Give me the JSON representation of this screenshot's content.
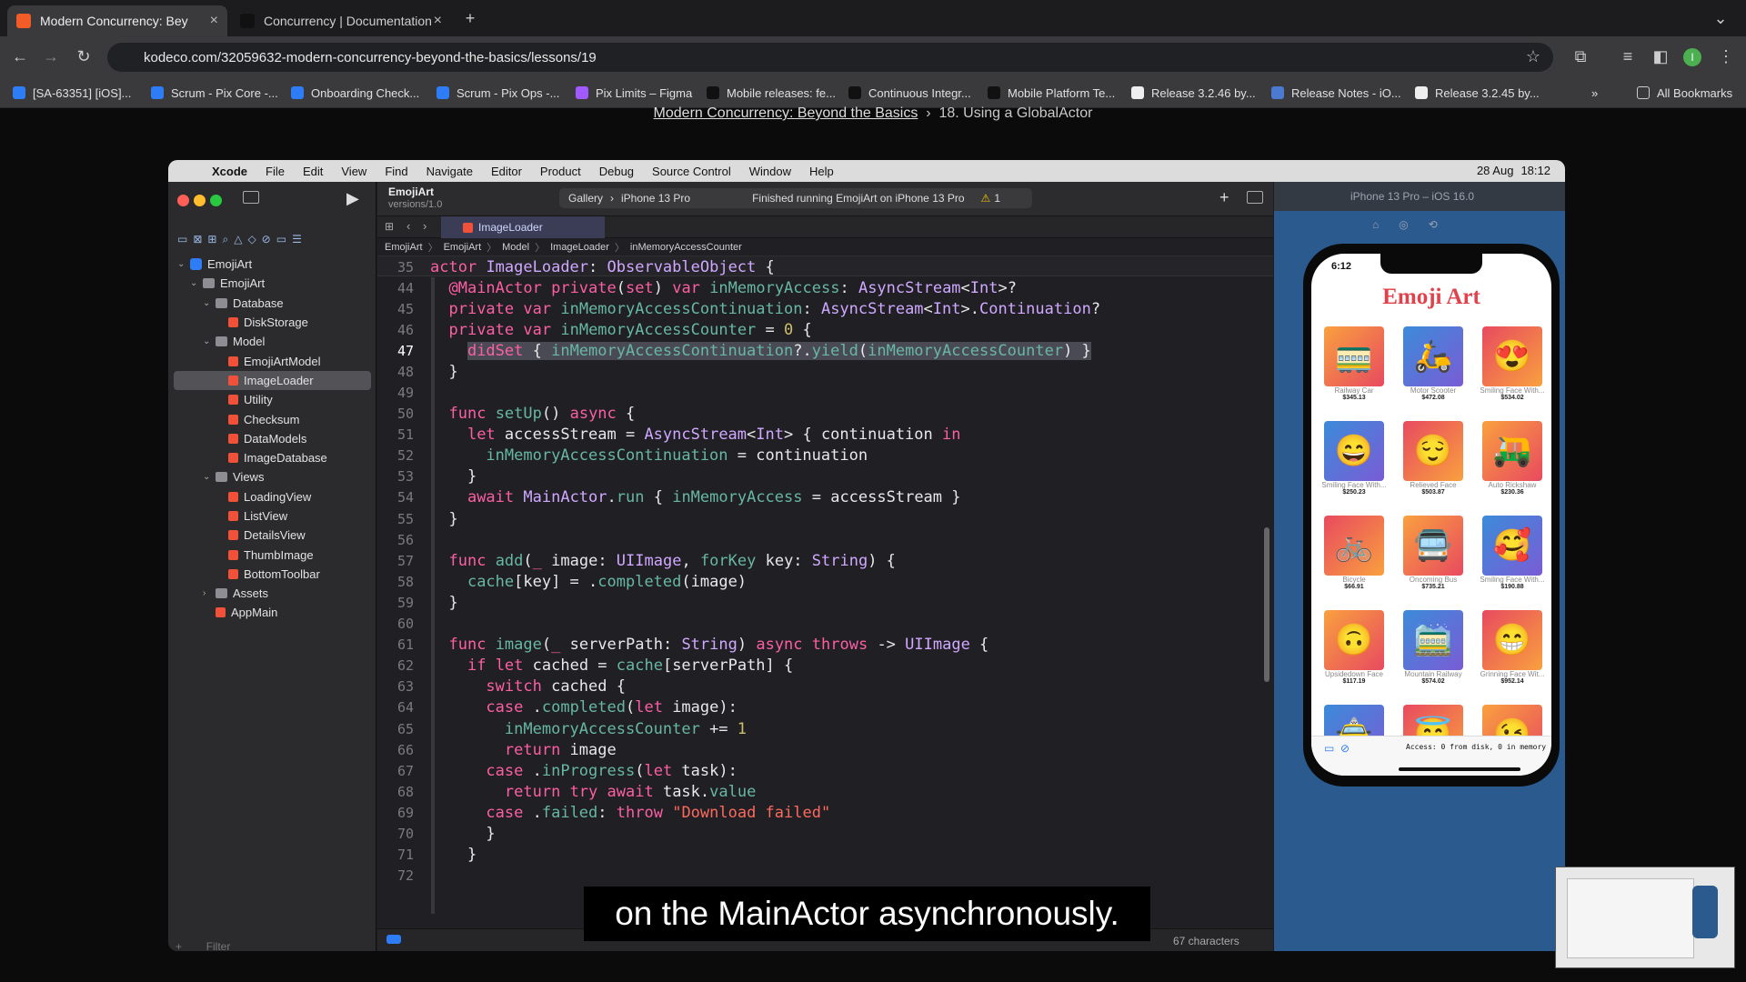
{
  "browser": {
    "tabs": [
      {
        "label": "Modern Concurrency: Bey",
        "icon": "kodeco-icon"
      },
      {
        "label": "Concurrency | Documentation",
        "icon": "apple-icon"
      }
    ],
    "url": "kodeco.com/32059632-modern-concurrency-beyond-the-basics/lessons/19",
    "bookmarks": [
      "[SA-63351] [iOS]...",
      "Scrum - Pix Core -...",
      "Onboarding Check...",
      "Scrum - Pix Ops -...",
      "Pix Limits – Figma",
      "Mobile releases: fe...",
      "Continuous Integr...",
      "Mobile Platform Te...",
      "Release 3.2.46 by...",
      "Release Notes - iO...",
      "Release 3.2.45 by..."
    ],
    "all_bookmarks": "All Bookmarks",
    "profile": "I"
  },
  "page": {
    "crumb1": "Modern Concurrency: Beyond the Basics",
    "sep": "›",
    "crumb2": "18. Using a GlobalActor"
  },
  "xcode": {
    "menu": [
      "Xcode",
      "File",
      "Edit",
      "View",
      "Find",
      "Navigate",
      "Editor",
      "Product",
      "Debug",
      "Source Control",
      "Window",
      "Help"
    ],
    "menu_right": {
      "date": "28 Aug",
      "time": "18:12"
    },
    "project": "EmojiArt",
    "version": "versions/1.0",
    "scheme": "Gallery",
    "device": "iPhone 13 Pro",
    "status": "Finished running EmojiArt on iPhone 13 Pro",
    "warnings": "1",
    "tab": "ImageLoader",
    "breadcrumbs": [
      "EmojiArt",
      "EmojiArt",
      "Model",
      "ImageLoader",
      "inMemoryAccessCounter"
    ],
    "tree": [
      {
        "label": "EmojiArt",
        "indent": 0,
        "kind": "app",
        "chev": "⌄"
      },
      {
        "label": "EmojiArt",
        "indent": 1,
        "kind": "folder",
        "chev": "⌄"
      },
      {
        "label": "Database",
        "indent": 2,
        "kind": "folder",
        "chev": "⌄"
      },
      {
        "label": "DiskStorage",
        "indent": 3,
        "kind": "swift"
      },
      {
        "label": "Model",
        "indent": 2,
        "kind": "folder",
        "chev": "⌄"
      },
      {
        "label": "EmojiArtModel",
        "indent": 3,
        "kind": "swift"
      },
      {
        "label": "ImageLoader",
        "indent": 3,
        "kind": "swift",
        "selected": true
      },
      {
        "label": "Utility",
        "indent": 3,
        "kind": "swift"
      },
      {
        "label": "Checksum",
        "indent": 3,
        "kind": "swift"
      },
      {
        "label": "DataModels",
        "indent": 3,
        "kind": "swift"
      },
      {
        "label": "ImageDatabase",
        "indent": 3,
        "kind": "swift"
      },
      {
        "label": "Views",
        "indent": 2,
        "kind": "folder",
        "chev": "⌄"
      },
      {
        "label": "LoadingView",
        "indent": 3,
        "kind": "swift"
      },
      {
        "label": "ListView",
        "indent": 3,
        "kind": "swift"
      },
      {
        "label": "DetailsView",
        "indent": 3,
        "kind": "swift"
      },
      {
        "label": "ThumbImage",
        "indent": 3,
        "kind": "swift"
      },
      {
        "label": "BottomToolbar",
        "indent": 3,
        "kind": "swift"
      },
      {
        "label": "Assets",
        "indent": 2,
        "kind": "folder",
        "chev": "›"
      },
      {
        "label": "AppMain",
        "indent": 2,
        "kind": "swift"
      }
    ],
    "filter_placeholder": "Filter",
    "sticky": {
      "num": "35",
      "html": "<span class='kw'>actor</span> <span class='ty'>ImageLoader</span>: <span class='ty'>ObservableObject</span> {"
    },
    "code": [
      {
        "n": "44",
        "h": "  <span class='kw'>@MainActor</span> <span class='kw'>private</span>(<span class='kw'>set</span>) <span class='kw'>var</span> <span class='pr'>inMemoryAccess</span>: <span class='ty'>AsyncStream</span>&lt;<span class='ty'>Int</span>&gt;?"
      },
      {
        "n": "45",
        "h": "  <span class='kw'>private</span> <span class='kw'>var</span> <span class='pr'>inMemoryAccessContinuation</span>: <span class='ty'>AsyncStream</span>&lt;<span class='ty'>Int</span>&gt;.<span class='ty'>Continuation</span>?"
      },
      {
        "n": "46",
        "h": "  <span class='kw'>private</span> <span class='kw'>var</span> <span class='pr'>inMemoryAccessCounter</span> = <span class='nu'>0</span> {"
      },
      {
        "n": "47",
        "h": "    <span class='hl'><span class='kw'>didSet</span> { <span class='pr'>inMemoryAccessContinuation</span>?.<span class='pr'>yield</span>(<span class='pr'>inMemoryAccessCounter</span>) }</span>",
        "cur": true
      },
      {
        "n": "48",
        "h": "  }"
      },
      {
        "n": "49",
        "h": ""
      },
      {
        "n": "50",
        "h": "  <span class='kw'>func</span> <span class='pr'>setUp</span>() <span class='kw'>async</span> {"
      },
      {
        "n": "51",
        "h": "    <span class='kw'>let</span> accessStream = <span class='ty'>AsyncStream</span>&lt;<span class='ty'>Int</span>&gt; { continuation <span class='kw'>in</span>"
      },
      {
        "n": "52",
        "h": "      <span class='pr'>inMemoryAccessContinuation</span> = continuation"
      },
      {
        "n": "53",
        "h": "    }"
      },
      {
        "n": "54",
        "h": "    <span class='kw'>await</span> <span class='ty'>MainActor</span>.<span class='pr'>run</span> { <span class='pr'>inMemoryAccess</span> = accessStream }"
      },
      {
        "n": "55",
        "h": "  }"
      },
      {
        "n": "56",
        "h": ""
      },
      {
        "n": "57",
        "h": "  <span class='kw'>func</span> <span class='pr'>add</span>(<span class='kw'>_</span> image: <span class='ty'>UIImage</span>, <span class='pr'>forKey</span> key: <span class='ty'>String</span>) {"
      },
      {
        "n": "58",
        "h": "    <span class='pr'>cache</span>[key] = .<span class='pr'>completed</span>(image)"
      },
      {
        "n": "59",
        "h": "  }"
      },
      {
        "n": "60",
        "h": ""
      },
      {
        "n": "61",
        "h": "  <span class='kw'>func</span> <span class='pr'>image</span>(<span class='kw'>_</span> serverPath: <span class='ty'>String</span>) <span class='kw'>async</span> <span class='kw'>throws</span> -&gt; <span class='ty'>UIImage</span> {"
      },
      {
        "n": "62",
        "h": "    <span class='kw'>if</span> <span class='kw'>let</span> cached = <span class='pr'>cache</span>[serverPath] {"
      },
      {
        "n": "63",
        "h": "      <span class='kw'>switch</span> cached {"
      },
      {
        "n": "64",
        "h": "      <span class='kw'>case</span> .<span class='pr'>completed</span>(<span class='kw'>let</span> image):"
      },
      {
        "n": "65",
        "h": "        <span class='pr'>inMemoryAccessCounter</span> += <span class='nu'>1</span>"
      },
      {
        "n": "66",
        "h": "        <span class='kw'>return</span> image"
      },
      {
        "n": "67",
        "h": "      <span class='kw'>case</span> .<span class='pr'>inProgress</span>(<span class='kw'>let</span> task):"
      },
      {
        "n": "68",
        "h": "        <span class='kw'>return</span> <span class='kw'>try</span> <span class='kw'>await</span> task.<span class='pr'>value</span>"
      },
      {
        "n": "69",
        "h": "      <span class='kw'>case</span> .<span class='pr'>failed</span>: <span class='kw'>throw</span> <span class='st'>\"Download failed\"</span>"
      },
      {
        "n": "70",
        "h": "      }"
      },
      {
        "n": "71",
        "h": "    }"
      },
      {
        "n": "72",
        "h": ""
      }
    ],
    "char_count": "67 characters"
  },
  "simulator": {
    "title": "iPhone 13 Pro – iOS 16.0",
    "time": "6:12",
    "app_title": "Emoji Art",
    "items": [
      {
        "emoji": "🚃",
        "name": "Railway Car",
        "price": "$345.13"
      },
      {
        "emoji": "🛵",
        "name": "Motor Scooter",
        "price": "$472.08"
      },
      {
        "emoji": "😍",
        "name": "Smiling Face With...",
        "price": "$534.02"
      },
      {
        "emoji": "😄",
        "name": "Smiling Face With...",
        "price": "$250.23"
      },
      {
        "emoji": "😌",
        "name": "Relieved Face",
        "price": "$503.87"
      },
      {
        "emoji": "🛺",
        "name": "Auto Rickshaw",
        "price": "$230.36"
      },
      {
        "emoji": "🚲",
        "name": "Bicycle",
        "price": "$66.91"
      },
      {
        "emoji": "🚍",
        "name": "Oncoming Bus",
        "price": "$735.21"
      },
      {
        "emoji": "🥰",
        "name": "Smiling Face With...",
        "price": "$190.88"
      },
      {
        "emoji": "🙃",
        "name": "Upsidedown Face",
        "price": "$117.19"
      },
      {
        "emoji": "🚞",
        "name": "Mountain Railway",
        "price": "$574.02"
      },
      {
        "emoji": "😁",
        "name": "Grinning Face Wit...",
        "price": "$952.14"
      },
      {
        "emoji": "🚖",
        "name": "",
        "price": ""
      },
      {
        "emoji": "😇",
        "name": "",
        "price": ""
      },
      {
        "emoji": "😉",
        "name": "",
        "price": ""
      }
    ],
    "status": "Access: 0 from disk, 0 in memory"
  },
  "subtitle": "on the MainActor asynchronously.",
  "colors": {
    "xcode_bg": "#1f1f24",
    "keyword": "#fc5fa3",
    "type": "#d0a8ff",
    "property": "#67b7a4",
    "swift_icon": "#f05138",
    "accent": "#2e7cf6"
  }
}
